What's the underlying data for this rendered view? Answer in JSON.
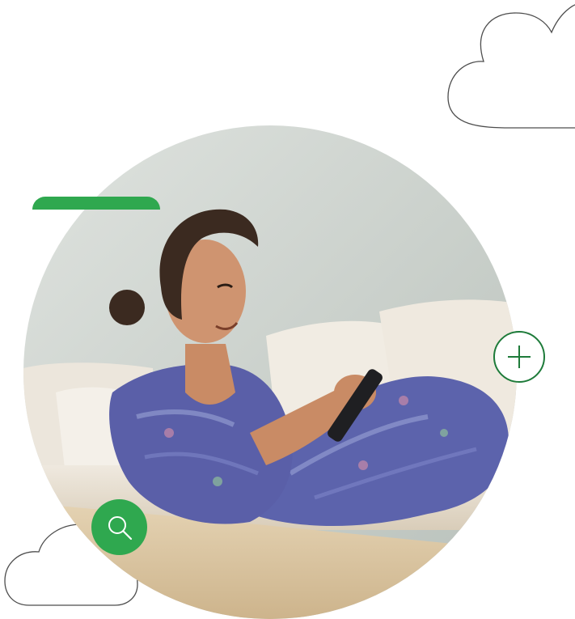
{
  "colors": {
    "accent_green": "#2fa84f",
    "dark_green": "#1e7b3a",
    "cloud_stroke": "#4d4d4d",
    "wall": "#c9cfca",
    "sofa": "#e9e2d6",
    "skin": "#c98b65",
    "hair": "#3b2a20",
    "robe": "#5a5fa8"
  },
  "icons": {
    "plus": "plus-icon",
    "search": "search-icon",
    "cloud": "cloud-outline-icon"
  }
}
